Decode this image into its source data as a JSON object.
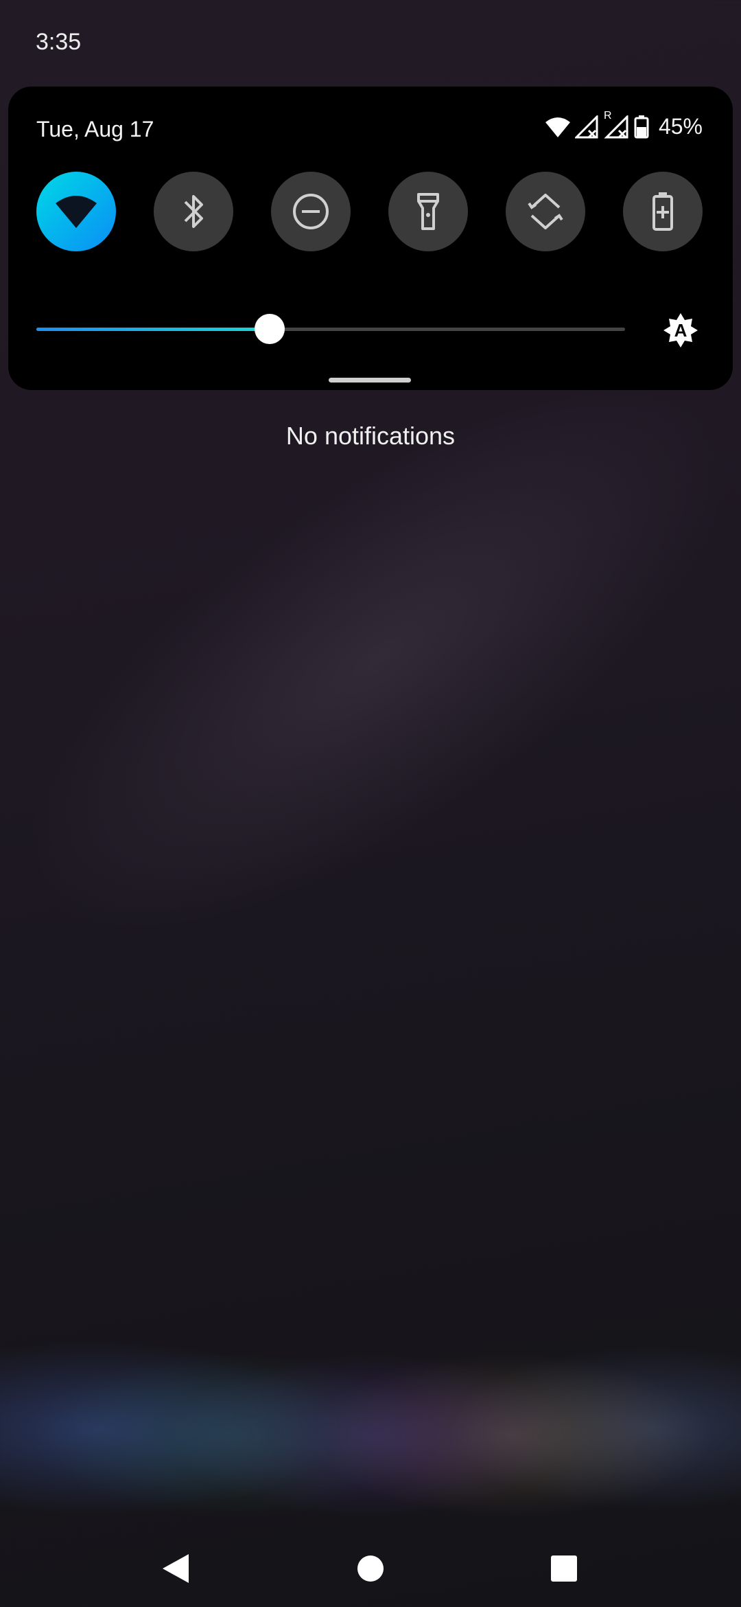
{
  "status_bar": {
    "time": "3:35"
  },
  "quick_settings": {
    "date": "Tue, Aug 17",
    "roaming_indicator": "R",
    "battery_percent": "45%",
    "status_icons": [
      "wifi-icon",
      "signal-no-service-icon",
      "signal-roaming-no-service-icon",
      "battery-icon"
    ],
    "tiles": [
      {
        "name": "wifi",
        "icon": "wifi-icon",
        "active": true
      },
      {
        "name": "bluetooth",
        "icon": "bluetooth-icon",
        "active": false
      },
      {
        "name": "do-not-disturb",
        "icon": "do-not-disturb-icon",
        "active": false
      },
      {
        "name": "flashlight",
        "icon": "flashlight-icon",
        "active": false
      },
      {
        "name": "auto-rotate",
        "icon": "auto-rotate-icon",
        "active": false
      },
      {
        "name": "battery-saver",
        "icon": "battery-saver-icon",
        "active": false
      }
    ],
    "brightness": {
      "level": 0.396,
      "auto_label": "A",
      "icon": "auto-brightness-icon"
    }
  },
  "notifications": {
    "empty_text": "No notifications"
  },
  "navigation": {
    "buttons": [
      "back-icon",
      "home-icon",
      "recents-icon"
    ]
  },
  "colors": {
    "active_tile_start": "#00d8e6",
    "active_tile_end": "#0a8ef5",
    "inactive_tile": "#3a3a3a",
    "panel": "#000000"
  }
}
